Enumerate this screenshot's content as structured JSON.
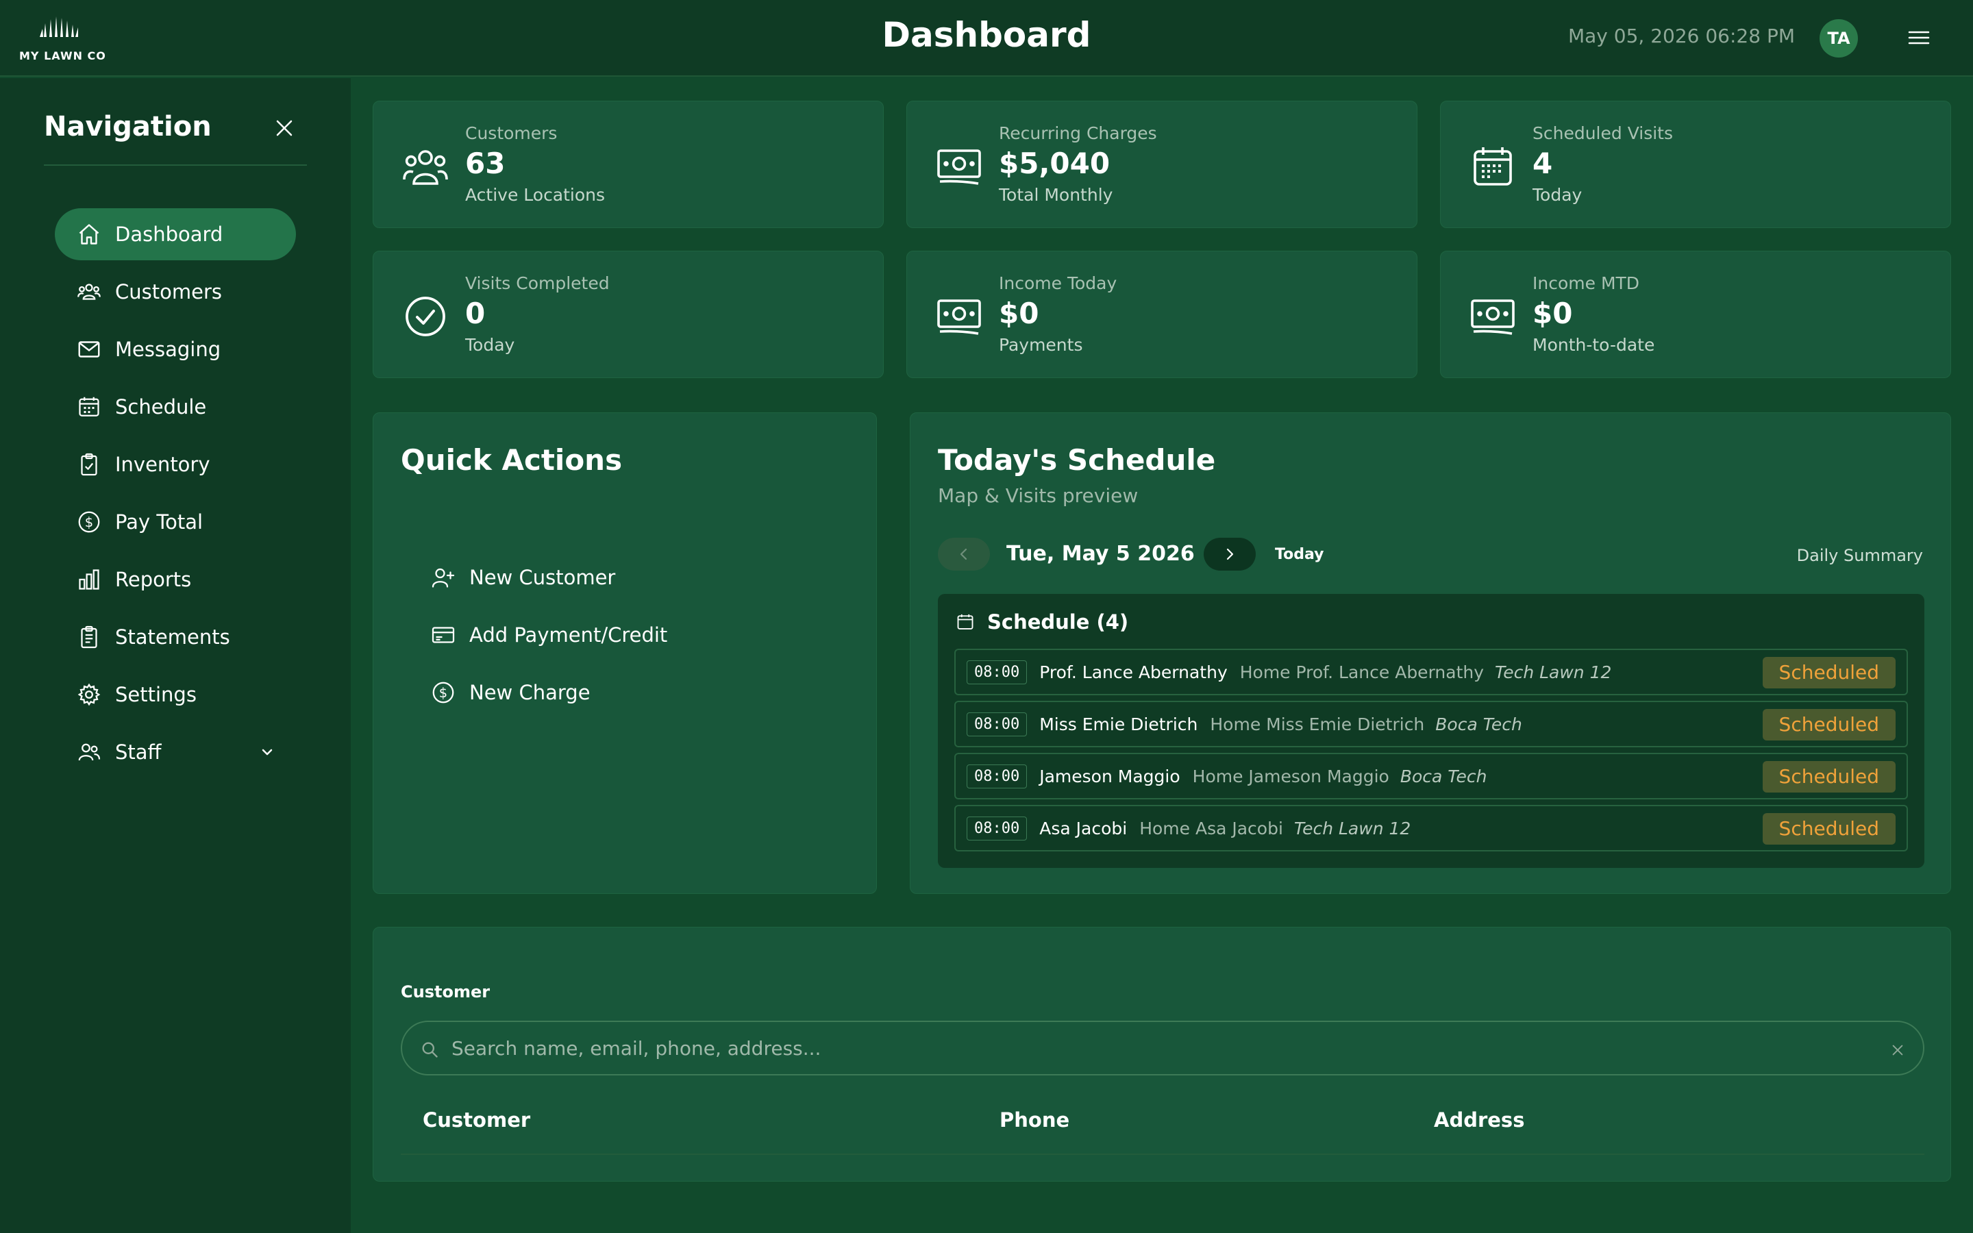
{
  "brand": {
    "logo_text": "MY LAWN CO"
  },
  "header": {
    "title": "Dashboard",
    "datetime": "May 05, 2026 06:28 PM",
    "avatar_initials": "TA"
  },
  "sidebar": {
    "title": "Navigation",
    "items": [
      {
        "label": "Dashboard",
        "icon": "home-icon",
        "active": true
      },
      {
        "label": "Customers",
        "icon": "users-icon"
      },
      {
        "label": "Messaging",
        "icon": "mail-icon"
      },
      {
        "label": "Schedule",
        "icon": "calendar-icon"
      },
      {
        "label": "Inventory",
        "icon": "clipboard-check-icon"
      },
      {
        "label": "Pay Total",
        "icon": "dollar-circle-icon"
      },
      {
        "label": "Reports",
        "icon": "bar-chart-icon"
      },
      {
        "label": "Statements",
        "icon": "receipt-icon"
      },
      {
        "label": "Settings",
        "icon": "gear-icon"
      },
      {
        "label": "Staff",
        "icon": "staff-icon"
      }
    ]
  },
  "stats": [
    {
      "label": "Customers",
      "value": "63",
      "sub": "Active Locations",
      "icon": "users-icon"
    },
    {
      "label": "Recurring Charges",
      "value": "$5,040",
      "sub": "Total Monthly",
      "icon": "cash-icon"
    },
    {
      "label": "Scheduled Visits",
      "value": "4",
      "sub": "Today",
      "icon": "calendar-icon"
    },
    {
      "label": "Visits Completed",
      "value": "0",
      "sub": "Today",
      "icon": "check-circle-icon"
    },
    {
      "label": "Income Today",
      "value": "$0",
      "sub": "Payments",
      "icon": "cash-icon"
    },
    {
      "label": "Income MTD",
      "value": "$0",
      "sub": "Month-to-date",
      "icon": "cash-icon"
    }
  ],
  "quick_actions": {
    "title": "Quick Actions",
    "items": [
      {
        "label": "New Customer",
        "icon": "user-plus-icon"
      },
      {
        "label": "Add Payment/Credit",
        "icon": "credit-card-icon"
      },
      {
        "label": "New Charge",
        "icon": "dollar-circle-icon"
      }
    ]
  },
  "schedule": {
    "title": "Today's Schedule",
    "subtitle": "Map & Visits preview",
    "date_label": "Tue, May 5 2026",
    "today_label": "Today",
    "daily_summary_label": "Daily Summary",
    "list_title": "Schedule (4)",
    "rows": [
      {
        "time": "08:00",
        "customer": "Prof. Lance Abernathy",
        "location": "Home Prof. Lance Abernathy",
        "tech": "Tech Lawn 12",
        "status": "Scheduled"
      },
      {
        "time": "08:00",
        "customer": "Miss Emie Dietrich",
        "location": "Home Miss Emie Dietrich",
        "tech": "Boca Tech",
        "status": "Scheduled"
      },
      {
        "time": "08:00",
        "customer": "Jameson Maggio",
        "location": "Home Jameson Maggio",
        "tech": "Boca Tech",
        "status": "Scheduled"
      },
      {
        "time": "08:00",
        "customer": "Asa Jacobi",
        "location": "Home Asa Jacobi",
        "tech": "Tech Lawn 12",
        "status": "Scheduled"
      }
    ]
  },
  "customer_search": {
    "label": "Customer",
    "placeholder": "Search name, email, phone, address...",
    "value": "",
    "columns": [
      "Customer",
      "Phone",
      "Address"
    ]
  },
  "colors": {
    "background": "#114a2c",
    "sidebar": "#0f3b24",
    "card": "#18573a",
    "active_nav": "#23744a",
    "status_text": "#f0a23a"
  }
}
